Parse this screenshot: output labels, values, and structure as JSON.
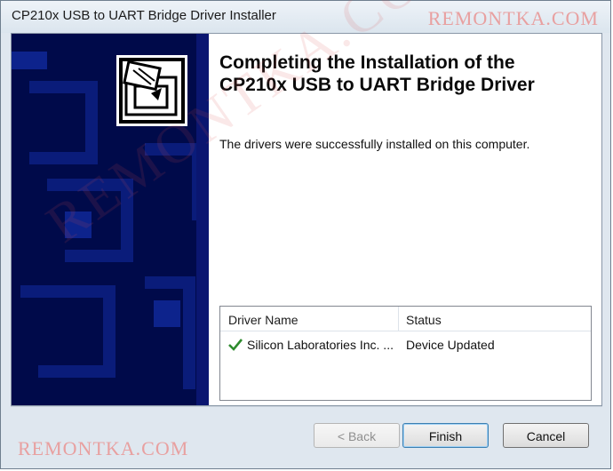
{
  "window": {
    "title": "CP210x USB to UART Bridge Driver Installer"
  },
  "main": {
    "heading_line1": "Completing the Installation of the",
    "heading_line2": "CP210x USB to UART Bridge Driver",
    "message": "The drivers were successfully installed on this computer."
  },
  "driver_list": {
    "columns": [
      "Driver Name",
      "Status"
    ],
    "rows": [
      {
        "name": "Silicon Laboratories Inc. ...",
        "status": "Device Updated",
        "icon": "check-icon"
      }
    ]
  },
  "buttons": {
    "back": "< Back",
    "finish": "Finish",
    "cancel": "Cancel"
  },
  "watermark": {
    "text": "REMONTKA.COM"
  },
  "colors": {
    "side_panel": "#000a4a",
    "check": "#2e8b2e",
    "watermark": "#e8a0a0"
  }
}
